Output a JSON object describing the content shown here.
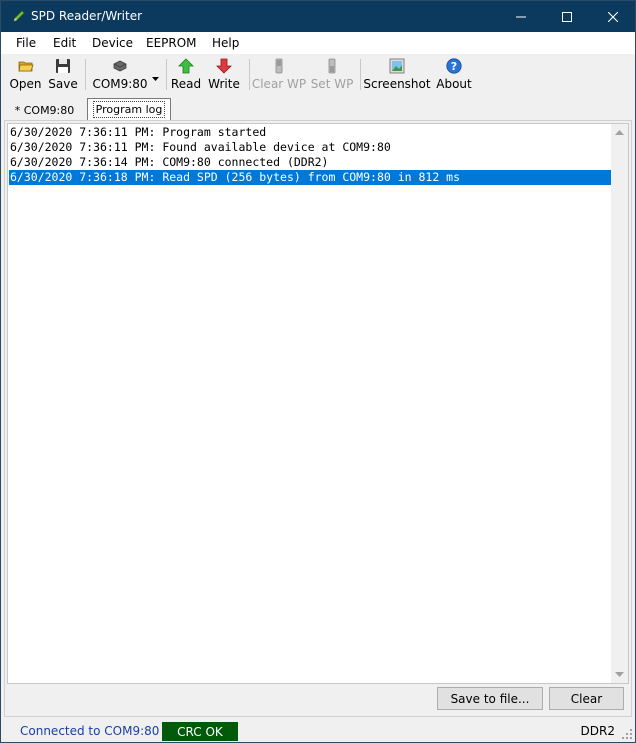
{
  "window": {
    "title": "SPD Reader/Writer"
  },
  "menu": [
    "File",
    "Edit",
    "Device",
    "EEPROM",
    "Help"
  ],
  "toolbar": {
    "open": "Open",
    "save": "Save",
    "port": "COM9:80",
    "read": "Read",
    "write": "Write",
    "clear_wp": "Clear WP",
    "set_wp": "Set WP",
    "screenshot": "Screenshot",
    "about": "About"
  },
  "tabs": [
    {
      "label": "* COM9:80",
      "active": false
    },
    {
      "label": "Program log",
      "active": true
    }
  ],
  "log": [
    "6/30/2020 7:36:11 PM: Program started",
    "6/30/2020 7:36:11 PM: Found available device at COM9:80",
    "6/30/2020 7:36:14 PM: COM9:80 connected (DDR2)",
    "6/30/2020 7:36:18 PM: Read SPD (256 bytes) from COM9:80 in 812 ms"
  ],
  "selected_log_index": 3,
  "buttons": {
    "save_to_file": "Save to file...",
    "clear": "Clear"
  },
  "status": {
    "connection": "Connected to COM9:80",
    "crc": "CRC OK",
    "ram_type": "DDR2"
  },
  "icons": {
    "app": "pencil-icon",
    "open": "folder-icon",
    "save": "floppy-icon",
    "port": "serial-device-icon",
    "read": "arrow-up-icon",
    "write": "arrow-down-icon",
    "clear_wp": "switch-icon",
    "set_wp": "switch-icon",
    "screenshot": "picture-icon",
    "about": "help-icon"
  },
  "colors": {
    "titlebar": "#0b3a5e",
    "selection": "#0078d7",
    "crc_ok": "#005a0a",
    "connection_text": "#1a3ea8"
  }
}
